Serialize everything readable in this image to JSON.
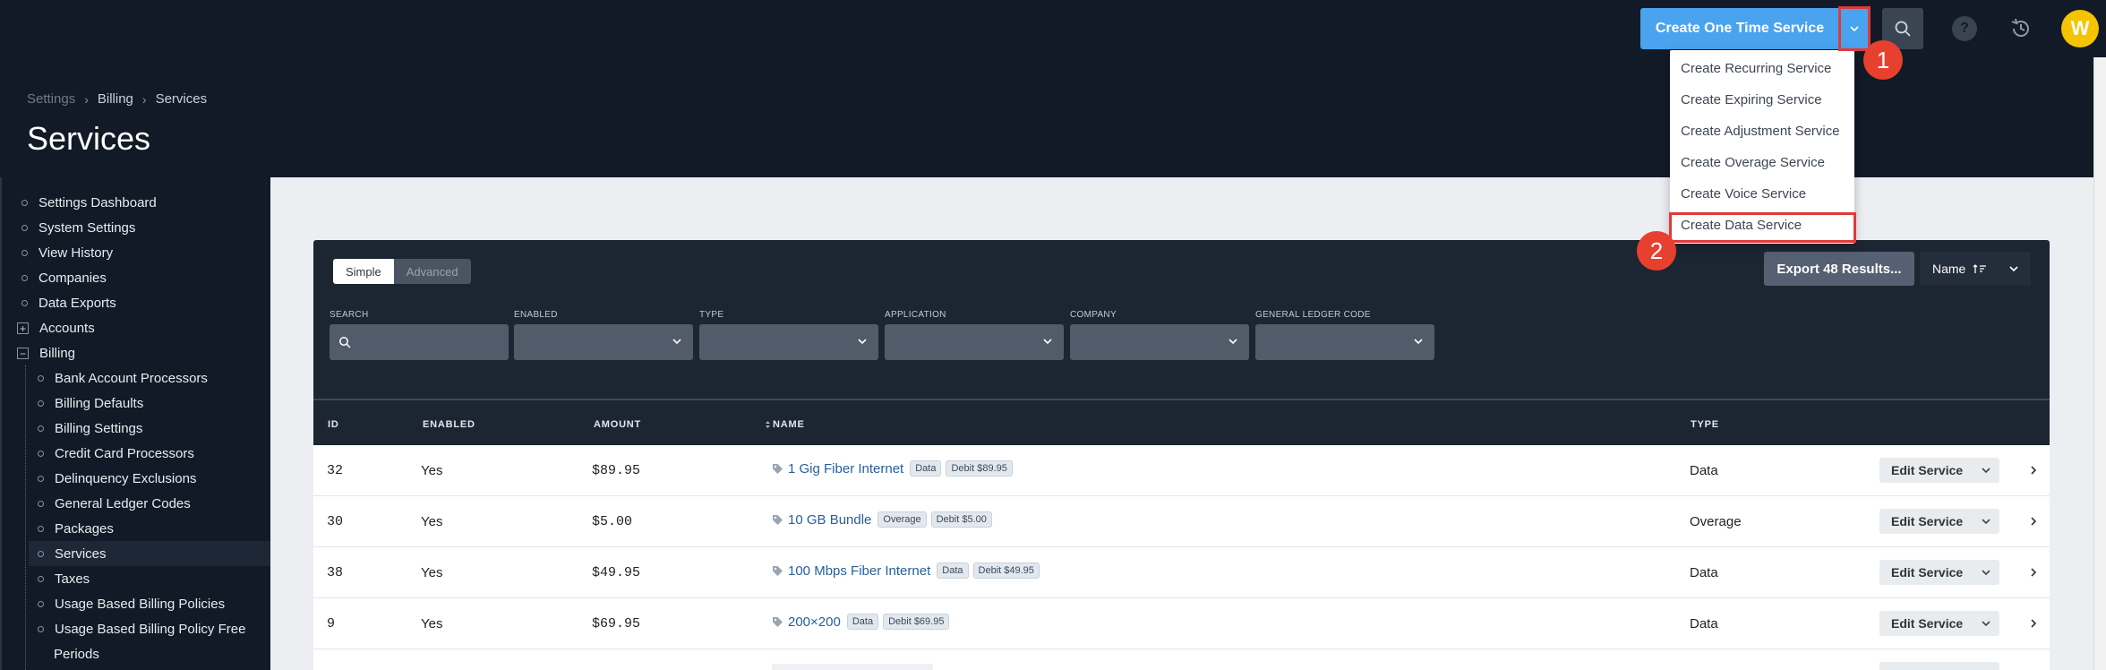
{
  "topbar": {
    "primary_button": "Create One Time Service",
    "help_glyph": "?",
    "avatar_initial": "W",
    "step1": "1",
    "step2": "2"
  },
  "dropdown": {
    "items": [
      "Create Recurring Service",
      "Create Expiring Service",
      "Create Adjustment Service",
      "Create Overage Service",
      "Create Voice Service",
      "Create Data Service"
    ]
  },
  "header": {
    "breadcrumb": [
      "Settings",
      "Billing",
      "Services"
    ],
    "title": "Services"
  },
  "sidebar": {
    "items": [
      "Settings Dashboard",
      "System Settings",
      "View History",
      "Companies",
      "Data Exports",
      "Accounts",
      "Billing"
    ],
    "billing_children": [
      "Bank Account Processors",
      "Billing Defaults",
      "Billing Settings",
      "Credit Card Processors",
      "Delinquency Exclusions",
      "General Ledger Codes",
      "Packages",
      "Services",
      "Taxes",
      "Usage Based Billing Policies",
      "Usage Based Billing Policy Free",
      "Periods"
    ]
  },
  "panel": {
    "toggle_simple": "Simple",
    "toggle_advanced": "Advanced",
    "export_button": "Export 48 Results...",
    "sort_label": "Name",
    "filters": [
      "SEARCH",
      "ENABLED",
      "TYPE",
      "APPLICATION",
      "COMPANY",
      "GENERAL LEDGER CODE"
    ]
  },
  "table": {
    "headers": [
      "ID",
      "ENABLED",
      "AMOUNT",
      "NAME",
      "TYPE"
    ],
    "edit_label": "Edit Service",
    "rows": [
      {
        "id": "32",
        "enabled": "Yes",
        "amount": "$89.95",
        "name": "1 Gig Fiber Internet",
        "tag1": "Data",
        "tag2": "Debit $89.95",
        "type": "Data"
      },
      {
        "id": "30",
        "enabled": "Yes",
        "amount": "$5.00",
        "name": "10 GB Bundle",
        "tag1": "Overage",
        "tag2": "Debit $5.00",
        "type": "Overage"
      },
      {
        "id": "38",
        "enabled": "Yes",
        "amount": "$49.95",
        "name": "100 Mbps Fiber Internet",
        "tag1": "Data",
        "tag2": "Debit $49.95",
        "type": "Data"
      },
      {
        "id": "9",
        "enabled": "Yes",
        "amount": "$69.95",
        "name": "200×200",
        "tag1": "Data",
        "tag2": "Debit $69.95",
        "type": "Data"
      }
    ]
  },
  "colors": {
    "topbar_bg": "#111a26",
    "accent": "#4aa3ef",
    "highlight": "#e03a3a",
    "avatar": "#f5c400"
  }
}
